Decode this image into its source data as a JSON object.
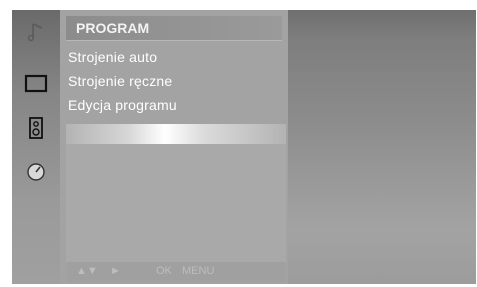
{
  "sidebar": {
    "icons": [
      "music-note-icon",
      "picture-icon",
      "speaker-icon",
      "clock-icon"
    ]
  },
  "menu": {
    "title": "PROGRAM",
    "items": [
      {
        "label": "Strojenie auto"
      },
      {
        "label": "Strojenie ręczne"
      },
      {
        "label": "Edycja programu"
      }
    ]
  },
  "footer": {
    "arrows": "▲▼",
    "ok_label": "OK",
    "menu_label": "MENU"
  },
  "colors": {
    "panel": "#a3a3a3",
    "text": "#ffffff",
    "header_text": "#f2f2f2",
    "highlight": "#ffffff"
  }
}
